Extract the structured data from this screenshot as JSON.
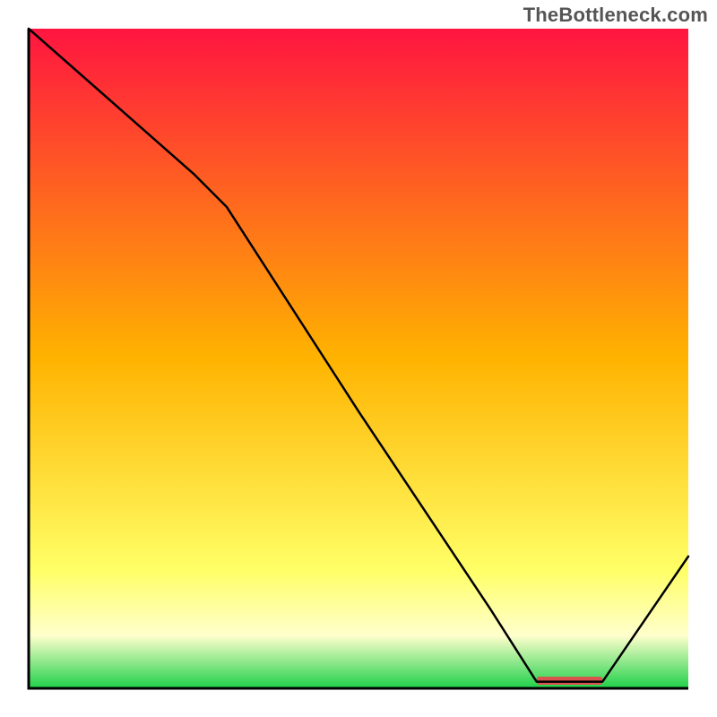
{
  "attribution": "TheBottleneck.com",
  "chart_data": {
    "type": "line",
    "title": "",
    "xlabel": "",
    "ylabel": "",
    "xlim": [
      0,
      100
    ],
    "ylim": [
      0,
      100
    ],
    "series": [
      {
        "name": "curve",
        "x": [
          0,
          25,
          30,
          50,
          70,
          77,
          87,
          100
        ],
        "y": [
          100,
          78,
          73,
          42,
          12,
          1,
          1,
          20
        ]
      }
    ],
    "optimal_band": {
      "x_start": 77,
      "x_end": 87,
      "label": "",
      "color": "#d9534f"
    },
    "gradient_stops": [
      {
        "pct": 0,
        "color": "#ff1540"
      },
      {
        "pct": 50,
        "color": "#ffb300"
      },
      {
        "pct": 82,
        "color": "#ffff66"
      },
      {
        "pct": 92,
        "color": "#ffffcc"
      },
      {
        "pct": 100,
        "color": "#1fd14a"
      }
    ],
    "axis_color": "#000000",
    "axis_width": 3,
    "line_color": "#000000",
    "line_width": 2.5
  }
}
